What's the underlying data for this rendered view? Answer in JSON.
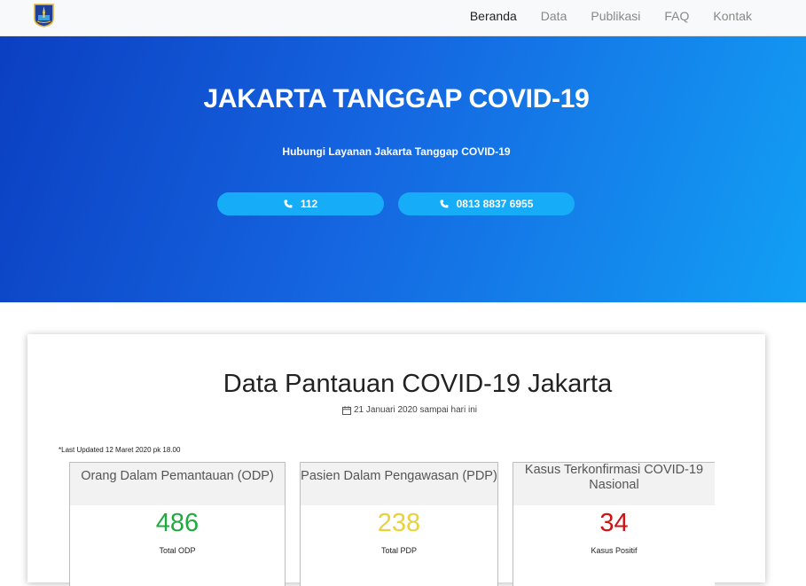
{
  "nav": {
    "logo": "jakarta-crest",
    "items": [
      {
        "label": "Beranda",
        "active": true
      },
      {
        "label": "Data",
        "active": false
      },
      {
        "label": "Publikasi",
        "active": false
      },
      {
        "label": "FAQ",
        "active": false
      },
      {
        "label": "Kontak",
        "active": false
      }
    ]
  },
  "hero": {
    "title": "JAKARTA TANGGAP COVID-19",
    "subtitle": "Hubungi Layanan Jakarta Tanggap COVID-19",
    "buttons": [
      {
        "label": "112",
        "icon": "phone-icon"
      },
      {
        "label": "0813 8837 6955",
        "icon": "phone-icon"
      }
    ],
    "gradient": [
      "#0b3fc2",
      "#12a0f5"
    ]
  },
  "data_section": {
    "title": "Data Pantauan COVID-19 Jakarta",
    "date_range": "21 Januari 2020 sampai hari ini",
    "last_updated": "*Last Updated 12 Maret 2020 pk 18.00",
    "stats": [
      {
        "header": "Orang Dalam Pemantauan (ODP)",
        "value": "486",
        "label": "Total ODP",
        "color": "#1fab3f"
      },
      {
        "header": "Pasien Dalam Pengawasan (PDP)",
        "value": "238",
        "label": "Total PDP",
        "color": "#ead23a"
      },
      {
        "header": "Kasus Terkonfirmasi COVID-19 Nasional",
        "value": "34",
        "label": "Kasus Positif",
        "color": "#d01212"
      }
    ]
  }
}
